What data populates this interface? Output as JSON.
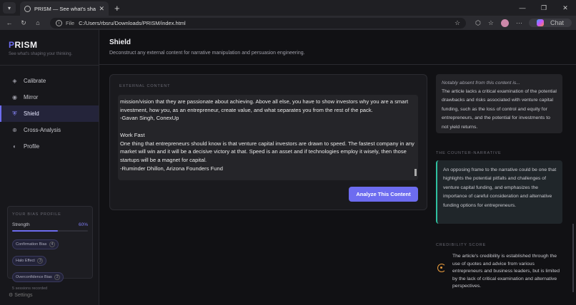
{
  "browser": {
    "tab_title": "PRISM — See what's shaping your",
    "address": "C:/Users/rbsru/Downloads/PRISM/index.html",
    "file_label": "File",
    "chat_label": "Chat"
  },
  "sidebar": {
    "brand_p": "P",
    "brand_rest": "RISM",
    "tagline": "See what's shaping your thinking.",
    "items": [
      {
        "label": "Calibrate",
        "icon": "◈"
      },
      {
        "label": "Mirror",
        "icon": "◉"
      },
      {
        "label": "Shield",
        "icon": "⛨"
      },
      {
        "label": "Cross-Analysis",
        "icon": "⊕"
      },
      {
        "label": "Profile",
        "icon": "◐"
      }
    ],
    "bias_profile": {
      "heading": "YOUR BIAS PROFILE",
      "strength_label": "Strength",
      "strength_value": "60%",
      "strength_fraction": 0.6,
      "biases": [
        {
          "name": "Confirmation Bias",
          "count": "4"
        },
        {
          "name": "Halo Effect",
          "count": "3"
        },
        {
          "name": "Overconfidence Bias",
          "count": "2"
        }
      ],
      "sessions": "5 sessions recorded"
    },
    "settings": "Settings"
  },
  "main": {
    "title": "Shield",
    "description": "Deconstruct any external content for narrative manipulation and persuasion engineering.",
    "input_label": "EXTERNAL CONTENT",
    "content_text": "mission/vision that they are passionate about achieving. Above all else, you have to show investors why you are a smart investment, how you, as an entrepreneur, create value, and what separates you from the rest of the pack.\n-Gavan Singh, ConexUp\n\nWork Fast\nOne thing that entrepreneurs should know is that venture capital investors are drawn to speed. The fastest company in any market will win and it will be a decisive victory at that. Speed is an asset and if technologies employ it wisely, then those startups will be a magnet for capital.\n-Ruminder Dhillon, Arizona Founders Fund",
    "analyze_button": "Analyze This Content"
  },
  "results": {
    "absent_heading": "Notably absent from this content is...",
    "absent_body": "The article lacks a critical examination of the potential drawbacks and risks associated with venture capital funding, such as the loss of control and equity for entrepreneurs, and the potential for investments to not yield returns.",
    "counter_label": "THE COUNTER-NARRATIVE",
    "counter_body": "An opposing frame to the narrative could be one that highlights the potential pitfalls and challenges of venture capital funding, and emphasizes the importance of careful consideration and alternative funding options for entrepreneurs.",
    "credibility_label": "CREDIBILITY SCORE",
    "credibility_body": "The article's credibility is established through the use of quotes and advice from various entrepreneurs and business leaders, but is limited by the lack of critical examination and alternative perspectives."
  }
}
